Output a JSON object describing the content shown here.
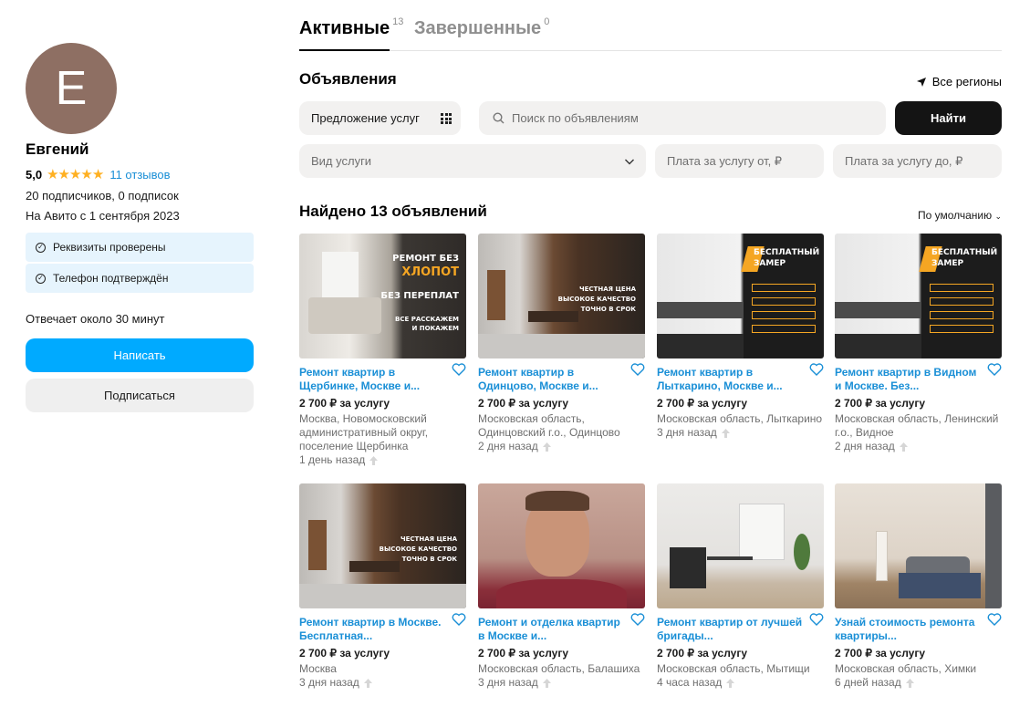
{
  "profile": {
    "avatar_letter": "Е",
    "name": "Евгений",
    "rating": "5,0",
    "stars": "★★★★★",
    "reviews_link": "11 отзывов",
    "subscribers": "20 подписчиков, 0 подписок",
    "since": "На Авито с 1 сентября 2023",
    "verifications": [
      "Реквизиты проверены",
      "Телефон подтверждён"
    ],
    "response_time": "Отвечает около 30 минут",
    "write_button": "Написать",
    "subscribe_button": "Подписаться"
  },
  "tabs": {
    "active_label": "Активные",
    "active_count": "13",
    "done_label": "Завершенные",
    "done_count": "0"
  },
  "listings": {
    "title": "Объявления",
    "regions": "Все регионы",
    "category": "Предложение услуг",
    "search_placeholder": "Поиск по объявлениям",
    "find_button": "Найти",
    "service_type": "Вид услуги",
    "price_from": "Плата за услугу от, ₽",
    "price_to": "Плата за услугу до, ₽",
    "found": "Найдено 13 объявлений",
    "sort": "По умолчанию"
  },
  "cards": [
    {
      "title": "Ремонт квартир в Щербинке, Москве и...",
      "price": "2 700 ₽ за услугу",
      "location": "Москва, Новомосковский административный округ, поселение Щербинка",
      "date": "1 день назад",
      "promo": [
        "РЕМОНТ БЕЗ",
        "ХЛОПОТ",
        "БЕЗ ПЕРЕПЛАТ",
        "ВСЕ РАССКАЖЕМ",
        "И ПОКАЖЕМ"
      ]
    },
    {
      "title": "Ремонт квартир в Одинцово, Москве и...",
      "price": "2 700 ₽ за услугу",
      "location": "Московская область, Одинцовский г.о., Одинцово",
      "date": "2 дня назад",
      "promo": [
        "ЧЕСТНАЯ ЦЕНА",
        "ВЫСОКОЕ КАЧЕСТВО",
        "ТОЧНО В СРОК"
      ]
    },
    {
      "title": "Ремонт квартир в Лыткарино, Москве и...",
      "price": "2 700 ₽ за услугу",
      "location": "Московская область, Лыткарино",
      "date": "3 дня назад",
      "promo": [
        "БЕСПЛАТНЫЙ",
        "ЗАМЕР"
      ]
    },
    {
      "title": "Ремонт квартир в Видном и Москве. Без...",
      "price": "2 700 ₽ за услугу",
      "location": "Московская область, Ленинский г.о., Видное",
      "date": "2 дня назад",
      "promo": [
        "БЕСПЛАТНЫЙ",
        "ЗАМЕР"
      ]
    },
    {
      "title": "Ремонт квартир в Москве. Бесплатная...",
      "price": "2 700 ₽ за услугу",
      "location": "Москва",
      "date": "3 дня назад",
      "promo": [
        "ЧЕСТНАЯ ЦЕНА",
        "ВЫСОКОЕ КАЧЕСТВО",
        "ТОЧНО В СРОК"
      ]
    },
    {
      "title": "Ремонт и отделка квартир в Москве и...",
      "price": "2 700 ₽ за услугу",
      "location": "Московская область, Балашиха",
      "date": "3 дня назад",
      "promo": []
    },
    {
      "title": "Ремонт квартир от лучшей бригады...",
      "price": "2 700 ₽ за услугу",
      "location": "Московская область, Мытищи",
      "date": "4 часа назад",
      "promo": []
    },
    {
      "title": "Узнай стоимость ремонта квартиры...",
      "price": "2 700 ₽ за услугу",
      "location": "Московская область, Химки",
      "date": "6 дней назад",
      "promo": []
    }
  ],
  "colors": {
    "accent_blue": "#00aaff",
    "link_blue": "#1a8fd6",
    "star_orange": "#ffb021",
    "avatar_bg": "#8e6f63"
  }
}
